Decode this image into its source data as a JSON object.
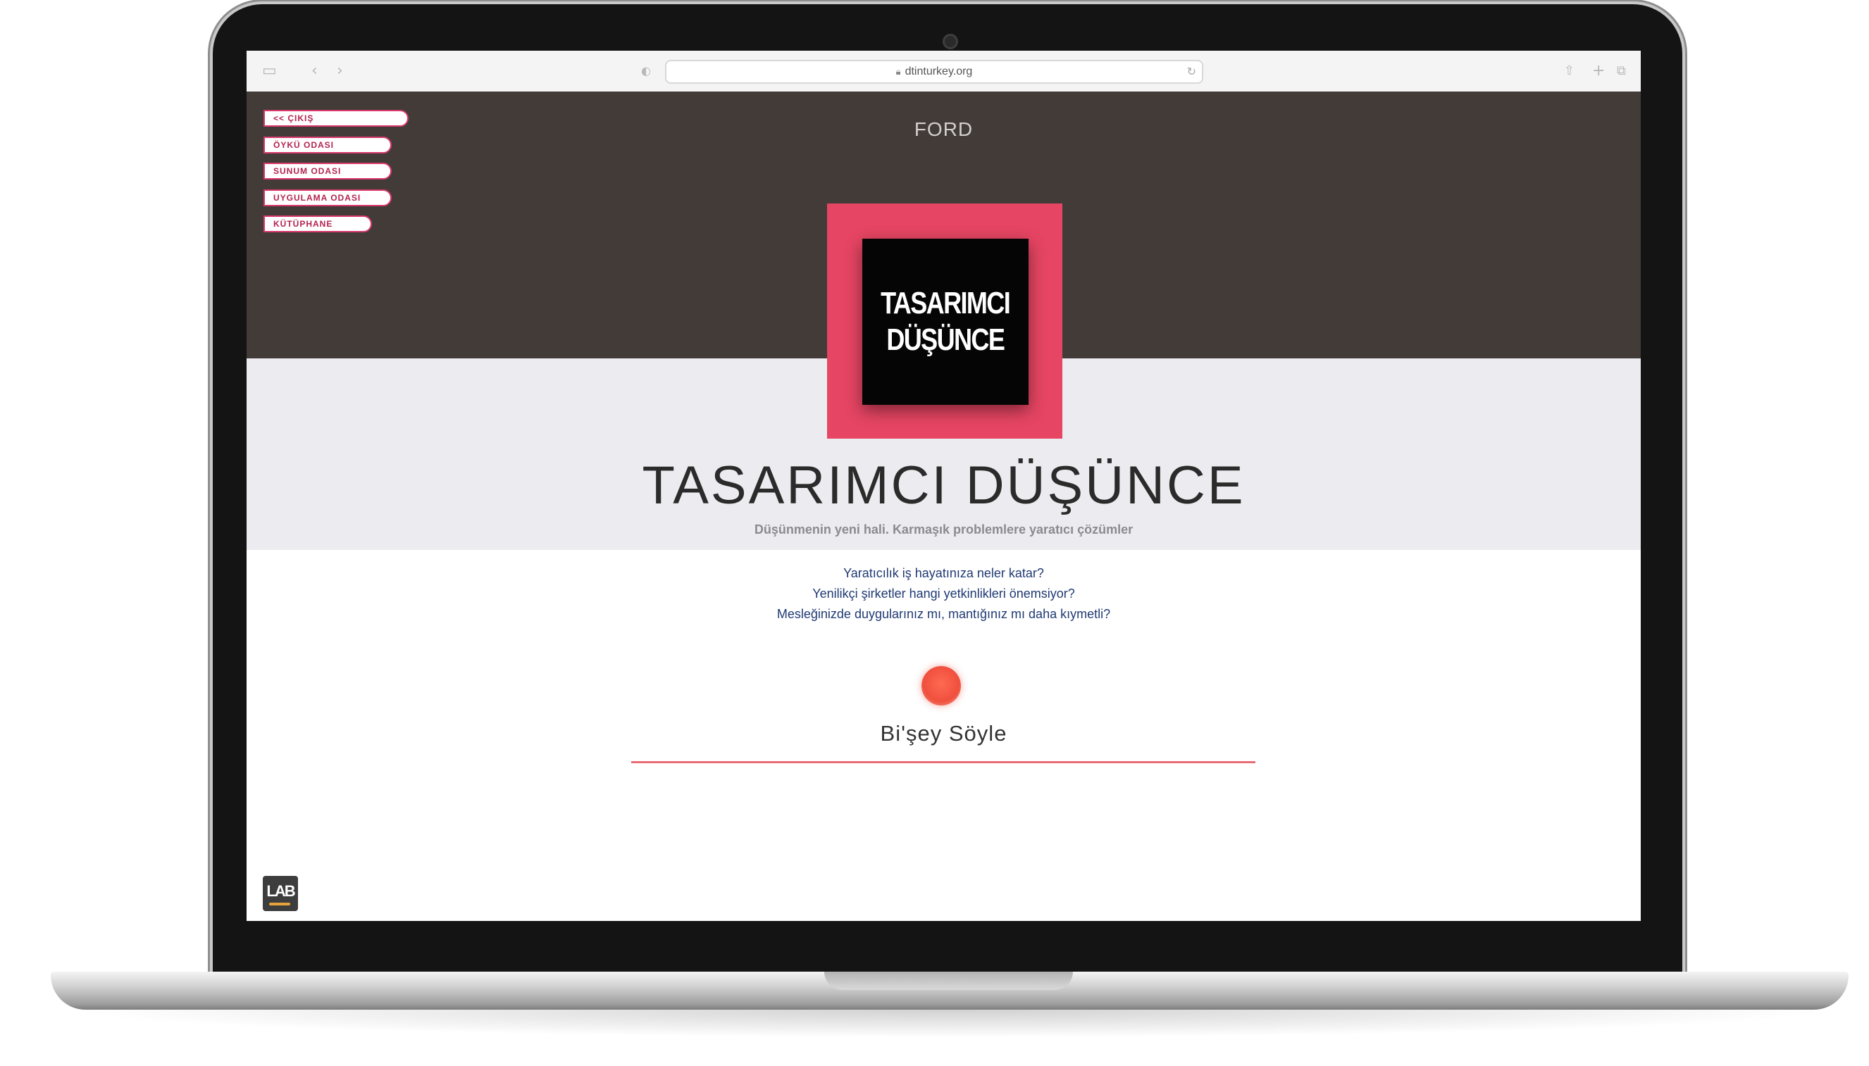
{
  "browser": {
    "url": "dtinturkey.org"
  },
  "header": {
    "brand": "FORD"
  },
  "side_nav": {
    "items": [
      {
        "label": "<< ÇIKIŞ"
      },
      {
        "label": "ÖYKÜ ODASI"
      },
      {
        "label": "SUNUM ODASI"
      },
      {
        "label": "UYGULAMA ODASI"
      },
      {
        "label": "KÜTÜPHANE"
      }
    ]
  },
  "logo": {
    "line1": "TASARIMCI",
    "line2": "DÜŞÜNCE"
  },
  "hero": {
    "title": "TASARIMCI DÜŞÜNCE",
    "subtitle": "Düşünmenin yeni hali. Karmaşık problemlere yaratıcı çözümler"
  },
  "questions": [
    "Yaratıcılık iş hayatınıza neler katar?",
    "Yenilikçi şirketler hangi yetkinlikleri önemsiyor?",
    "Mesleğinizde duygularınız mı, mantığınız mı daha kıymetli?"
  ],
  "voice": {
    "label": "Bi'şey Söyle"
  },
  "footer": {
    "badge": "LAB"
  },
  "colors": {
    "header_bg": "#433b38",
    "accent_pink": "#e64563",
    "record_red": "#f0503e",
    "question_blue": "#1f3a73",
    "band_gray": "#ecebef"
  },
  "icons": [
    "sidebar-toggle-icon",
    "back-arrow-icon",
    "forward-arrow-icon",
    "shield-icon",
    "lock-icon",
    "reload-icon",
    "share-icon",
    "new-tab-icon",
    "tabs-icon",
    "camera-icon",
    "record-icon"
  ]
}
